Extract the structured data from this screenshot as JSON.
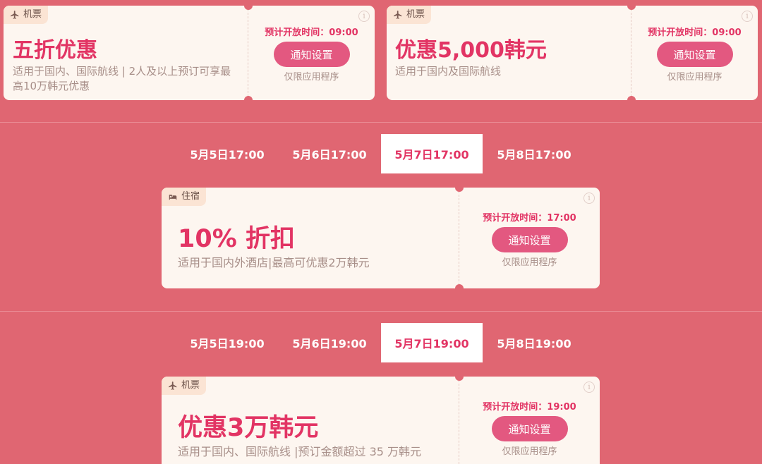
{
  "coupons": [
    {
      "tag": "机票",
      "tag_icon": "airplane-icon",
      "title": "五折优惠",
      "desc_line1": "适用于国内、国际航线 | 2人及以上预订可享最",
      "desc_line2": "高10万韩元优惠",
      "open_time": "预计开放时间：09:00",
      "button": "通知设置",
      "app_only": "仅限应用程序"
    },
    {
      "tag": "机票",
      "tag_icon": "airplane-icon",
      "title": "优惠5,000韩元",
      "desc_line1": "适用于国内及国际航线",
      "desc_line2": "",
      "open_time": "预计开放时间：09:00",
      "button": "通知设置",
      "app_only": "仅限应用程序"
    },
    {
      "tag": "住宿",
      "tag_icon": "bed-icon",
      "title": "10% 折扣",
      "desc_line1": "适用于国内外酒店|最高可优惠2万韩元",
      "desc_line2": "",
      "open_time": "预计开放时间：17:00",
      "button": "通知设置",
      "app_only": "仅限应用程序"
    },
    {
      "tag": "机票",
      "tag_icon": "airplane-icon",
      "title": "优惠3万韩元",
      "desc_line1": "适用于国内、国际航线 |预订金额超过 35 万韩元",
      "desc_line2": "",
      "open_time": "预计开放时间：19:00",
      "button": "通知设置",
      "app_only": "仅限应用程序"
    }
  ],
  "time_rows": [
    {
      "tabs": [
        "5月5日17:00",
        "5月6日17:00",
        "5月7日17:00",
        "5月8日17:00"
      ],
      "active": "5月7日17:00"
    },
    {
      "tabs": [
        "5月5日19:00",
        "5月6日19:00",
        "5月7日19:00",
        "5月8日19:00"
      ],
      "active": "5月7日19:00"
    }
  ],
  "colors": {
    "background": "#e06672",
    "accent": "#e23464",
    "button": "#e35880",
    "card": "#fdf6f0"
  }
}
